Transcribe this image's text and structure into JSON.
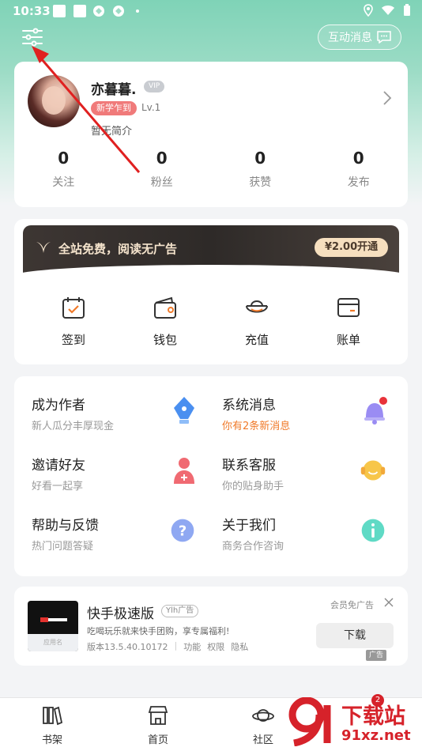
{
  "status_bar": {
    "time": "10:33"
  },
  "header": {
    "message_button": "互动消息"
  },
  "profile": {
    "name": "亦暮暮.",
    "vip": "VIP",
    "badge": "新学乍到",
    "level": "Lv.1",
    "bio": "暂无简介",
    "stats": [
      {
        "value": "0",
        "label": "关注"
      },
      {
        "value": "0",
        "label": "粉丝"
      },
      {
        "value": "0",
        "label": "获赞"
      },
      {
        "value": "0",
        "label": "发布"
      }
    ]
  },
  "vip_banner": {
    "text": "全站免费，阅读无广告",
    "button": "¥2.00开通"
  },
  "services": [
    {
      "label": "签到",
      "icon": "calendar-icon"
    },
    {
      "label": "钱包",
      "icon": "wallet-icon"
    },
    {
      "label": "充值",
      "icon": "ingot-icon"
    },
    {
      "label": "账单",
      "icon": "bill-icon"
    }
  ],
  "features": [
    {
      "title": "成为作者",
      "subtitle": "新人瓜分丰厚现金",
      "icon": "pen-icon"
    },
    {
      "title": "系统消息",
      "subtitle": "你有2条新消息",
      "icon": "bell-icon"
    },
    {
      "title": "邀请好友",
      "subtitle": "好看一起享",
      "icon": "add-friend-icon"
    },
    {
      "title": "联系客服",
      "subtitle": "你的贴身助手",
      "icon": "headset-icon"
    },
    {
      "title": "帮助与反馈",
      "subtitle": "热门问题答疑",
      "icon": "question-icon"
    },
    {
      "title": "关于我们",
      "subtitle": "商务合作咨询",
      "icon": "info-icon"
    }
  ],
  "ad": {
    "title": "快手极速版",
    "tag": "Ylh广告",
    "description": "吃喝玩乐就来快手团购，享专属福利!",
    "version": "版本13.5.40.10172",
    "links": [
      "功能",
      "权限",
      "隐私"
    ],
    "free_ad": "会员免广告",
    "download": "下载",
    "thumb_caption": "应用名",
    "ad_badge": "广告"
  },
  "bottom_nav": [
    {
      "label": "书架",
      "icon": "bookshelf-icon"
    },
    {
      "label": "首页",
      "icon": "store-icon"
    },
    {
      "label": "社区",
      "icon": "planet-icon"
    }
  ],
  "watermark": {
    "top": "下载站",
    "bottom": "91xz.net",
    "badge": "2"
  },
  "colors": {
    "accent": "#7fd3b7",
    "orange": "#f07a2a",
    "vip_gold": "#f6dfbf",
    "watermark_red": "#d6222a"
  }
}
